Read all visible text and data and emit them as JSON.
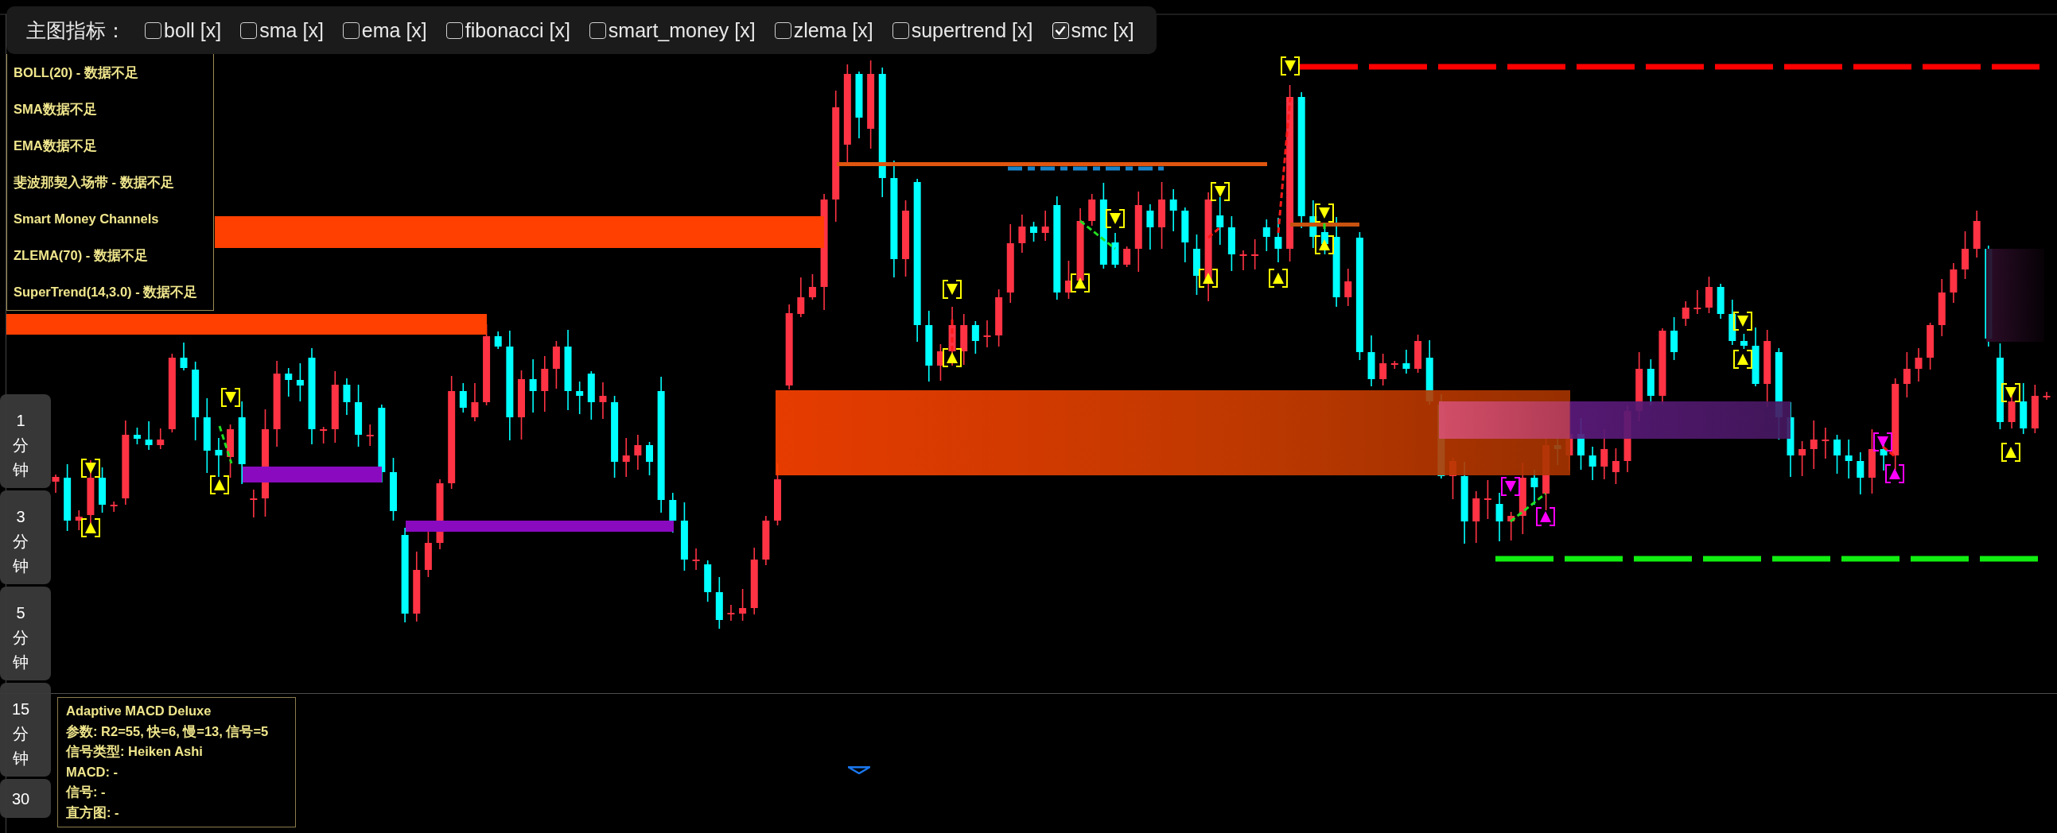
{
  "toolbar": {
    "title": "主图指标：",
    "indicators": [
      {
        "label": "boll [x]",
        "checked": false
      },
      {
        "label": "sma [x]",
        "checked": false
      },
      {
        "label": "ema [x]",
        "checked": false
      },
      {
        "label": "fibonacci [x]",
        "checked": false
      },
      {
        "label": "smart_money [x]",
        "checked": false
      },
      {
        "label": "zlema [x]",
        "checked": false
      },
      {
        "label": "supertrend [x]",
        "checked": false
      },
      {
        "label": "smc [x]",
        "checked": true
      }
    ]
  },
  "legend": {
    "lines": [
      "BOLL(20) - 数据不足",
      "SMA数据不足",
      "EMA数据不足",
      "斐波那契入场带 - 数据不足",
      "Smart Money Channels",
      "ZLEMA(70) - 数据不足",
      "SuperTrend(14,3.0) - 数据不足"
    ]
  },
  "timeframes": [
    "1分钟",
    "3分钟",
    "5分钟",
    "15分钟",
    "30"
  ],
  "macd_panel": {
    "title": "Adaptive MACD Deluxe",
    "lines": [
      "参数: R2=55, 快=6, 慢=13, 信号=5",
      "信号类型: Heiken Ashi",
      "MACD: -",
      "信号: -",
      "直方图: -"
    ]
  }
}
